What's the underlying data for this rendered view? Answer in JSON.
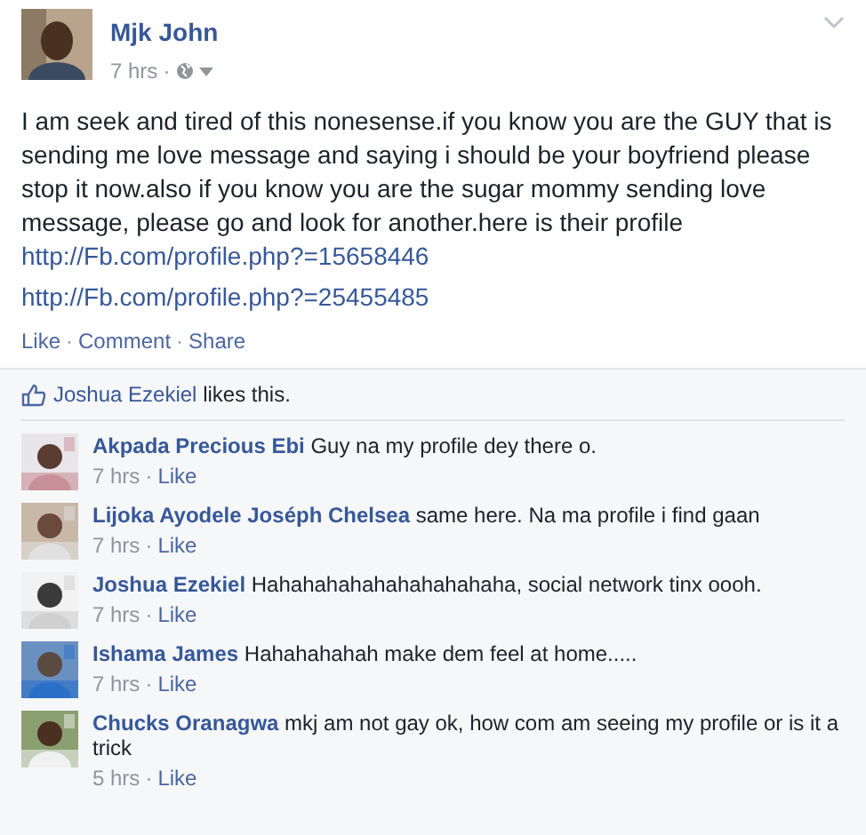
{
  "post": {
    "author": "Mjk John",
    "time": "7 hrs",
    "separator": "·",
    "message": "I am seek and tired of this nonesense.if you know you are the GUY that is sending me love message and saying i should be your boyfriend please stop it now.also if you know you are the sugar mommy sending love message, please go and look for another.here is their profile",
    "message_link": "http://Fb.com/profile.php?=15658446",
    "link": "http://Fb.com/profile.php?=25455485",
    "actions": [
      "Like",
      "Comment",
      "Share"
    ]
  },
  "likes": {
    "name": "Joshua Ezekiel",
    "text": "likes this."
  },
  "comments": [
    {
      "name": "Akpada Precious Ebi",
      "text": "Guy na my profile dey there o.",
      "time": "7 hrs",
      "action": "Like"
    },
    {
      "name": "Lijoka Ayodele Joséph Chelsea",
      "text": "same here. Na ma profile i find gaan",
      "time": "7 hrs",
      "action": "Like"
    },
    {
      "name": "Joshua Ezekiel",
      "text": "Hahahahahahahahahahaha, social network tinx oooh.",
      "time": "7 hrs",
      "action": "Like"
    },
    {
      "name": "Ishama James",
      "text": "Hahahahahah make dem feel at home.....",
      "time": "7 hrs",
      "action": "Like"
    },
    {
      "name": "Chucks Oranagwa",
      "text": "mkj am not gay ok, how com am seeing my profile or is it a trick",
      "time": "5 hrs",
      "action": "Like"
    }
  ]
}
